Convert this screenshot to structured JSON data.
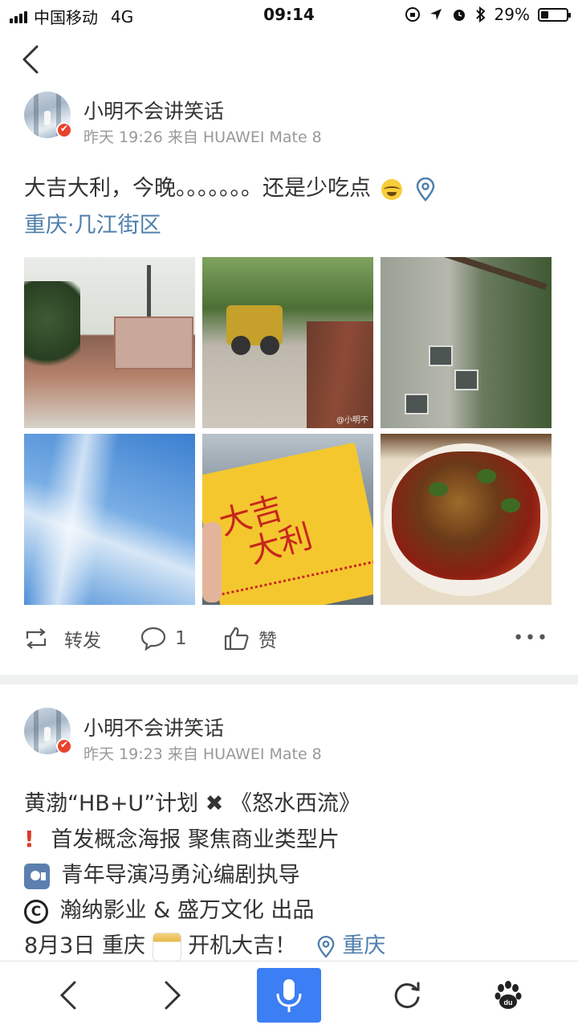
{
  "status_bar": {
    "carrier": "中国移动",
    "network": "4G",
    "time": "09:14",
    "battery_percent": "29%",
    "battery_level": 0.29
  },
  "nav": {
    "back_icon": "chevron-left-icon"
  },
  "posts": [
    {
      "username": "小明不会讲笑话",
      "time": "昨天 19:26",
      "source": "来自 HUAWEI Mate 8",
      "text": "大吉大利，今晚。。。。。。。还是少吃点",
      "location": "重庆·几江街区",
      "photo_watermark": "@小明不",
      "envelope_text_1": "大吉",
      "envelope_text_2": "大利",
      "actions": {
        "repost_label": "转发",
        "comment_count": "1",
        "like_label": "赞"
      }
    },
    {
      "username": "小明不会讲笑话",
      "time": "昨天 19:23",
      "source": "来自 HUAWEI Mate 8",
      "lines": [
        "黄渤“HB+U”计划",
        "《怒水西流》",
        "首发概念海报 聚焦商业类型片",
        "青年导演冯勇沁编剧执导",
        "瀚纳影业 & 盛万文化 出品",
        "8月3日 重庆",
        "开机大吉！",
        "重庆"
      ],
      "copyright_symbol": "C"
    }
  ],
  "bottom_bar": {
    "back_icon": "arrow-left-icon",
    "forward_icon": "arrow-right-icon",
    "voice_icon": "microphone-icon",
    "refresh_icon": "refresh-icon",
    "home_icon": "baidu-paw-icon",
    "home_label": "du"
  },
  "colors": {
    "link_blue": "#4f7fac",
    "mic_button": "#3c7ef3",
    "badge_red": "#e8432e"
  }
}
